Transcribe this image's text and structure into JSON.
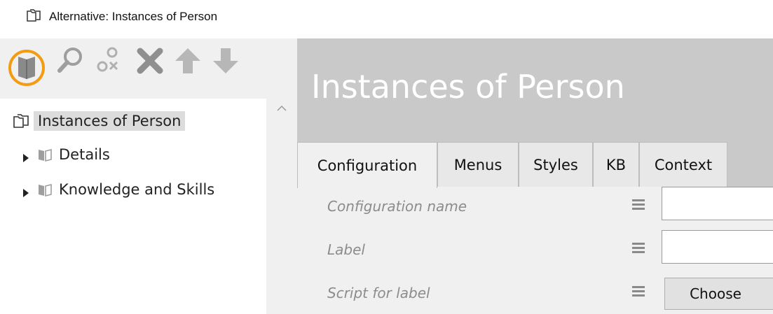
{
  "window": {
    "title": "Alternative: Instances of Person",
    "icon": "folder-outline-icon"
  },
  "toolbar": {
    "buttons": [
      {
        "name": "open-book-icon",
        "highlighted": true
      },
      {
        "name": "search-icon"
      },
      {
        "name": "disconnect-icon"
      },
      {
        "name": "delete-icon"
      },
      {
        "name": "move-up-icon"
      },
      {
        "name": "move-down-icon"
      }
    ],
    "highlight_color": "#f39c12"
  },
  "tree": {
    "root": {
      "label": "Instances of Person",
      "icon": "folder-outline-icon",
      "selected": true
    },
    "children": [
      {
        "label": "Details",
        "icon": "book-icon",
        "expander": "caret-right-icon"
      },
      {
        "label": "Knowledge and Skills",
        "icon": "book-icon",
        "expander": "caret-right-icon"
      }
    ]
  },
  "main": {
    "title": "Instances of Person",
    "tabs": [
      {
        "label": "Configuration",
        "active": true
      },
      {
        "label": "Menus"
      },
      {
        "label": "Styles"
      },
      {
        "label": "KB"
      },
      {
        "label": "Context"
      }
    ],
    "fields": [
      {
        "label": "Configuration name",
        "control": "input",
        "value": ""
      },
      {
        "label": "Label",
        "control": "input",
        "value": ""
      },
      {
        "label": "Script for label",
        "control": "button",
        "button_label": "Choose"
      }
    ]
  },
  "colors": {
    "header_bg": "#c9c9c9",
    "panel_bg": "#f0f0f0",
    "selection_bg": "#dcdcdc",
    "icon_gray": "#9e9e9e",
    "label_gray": "#8c8c8c"
  }
}
